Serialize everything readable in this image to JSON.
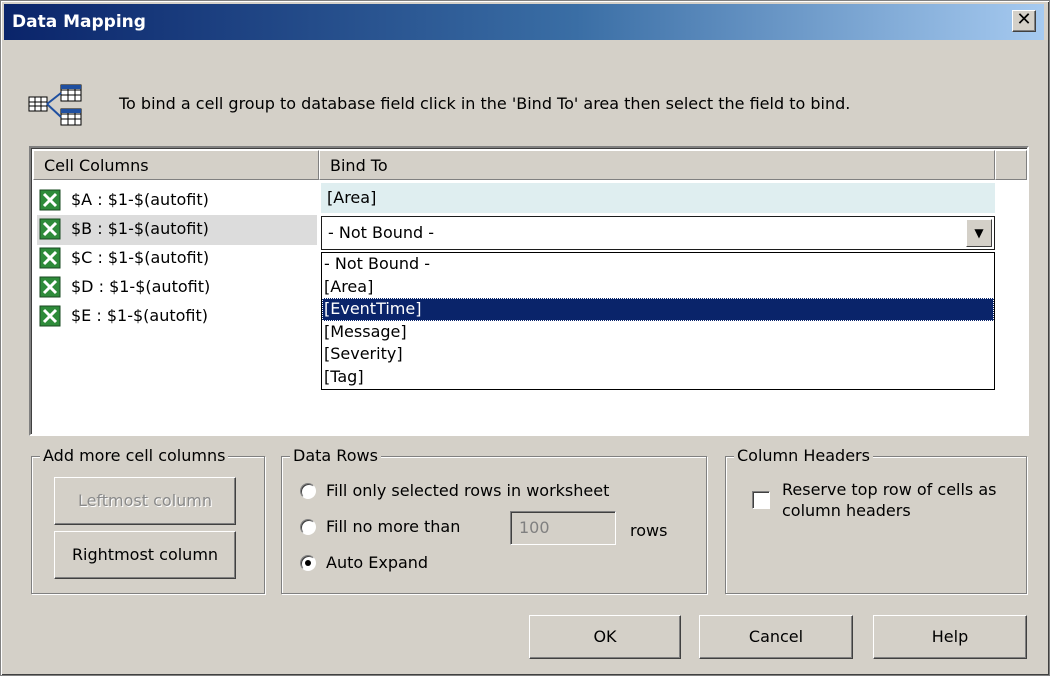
{
  "window": {
    "title": "Data Mapping",
    "close_glyph": "✕"
  },
  "info": {
    "icon": "table-link-icon",
    "text": "To bind a cell group to database field click in the 'Bind To' area then select the field to bind."
  },
  "grid": {
    "headers": [
      "Cell Columns",
      "Bind To"
    ],
    "rows": [
      {
        "label": "$A : $1-$(autofit)",
        "icon": "excel-icon"
      },
      {
        "label": "$B : $1-$(autofit)",
        "icon": "excel-icon"
      },
      {
        "label": "$C : $1-$(autofit)",
        "icon": "excel-icon"
      },
      {
        "label": "$D : $1-$(autofit)",
        "icon": "excel-icon"
      },
      {
        "label": "$E : $1-$(autofit)",
        "icon": "excel-icon"
      }
    ],
    "selected_row": 1,
    "bind_values": {
      "row_a": "[Area]",
      "row_b": "- Not Bound -"
    },
    "dropdown_options": [
      "- Not Bound -",
      "[Area]",
      "[EventTime]",
      "[Message]",
      "[Severity]",
      "[Tag]"
    ],
    "dropdown_highlighted": "[EventTime]"
  },
  "add_columns": {
    "legend": "Add more cell columns",
    "leftmost_label": "Leftmost column",
    "rightmost_label": "Rightmost column"
  },
  "data_rows": {
    "legend": "Data Rows",
    "option_selected": "Fill only selected rows in worksheet",
    "option_fill_max": "Fill no more than",
    "max_value": "100",
    "rows_label": "rows",
    "option_auto": "Auto Expand",
    "checked": "Auto Expand"
  },
  "column_headers": {
    "legend": "Column Headers",
    "reserve_label_line1": "Reserve top row of cells as",
    "reserve_label_line2": "column headers",
    "reserve_checked": false
  },
  "footer": {
    "ok": "OK",
    "cancel": "Cancel",
    "help": "Help"
  }
}
